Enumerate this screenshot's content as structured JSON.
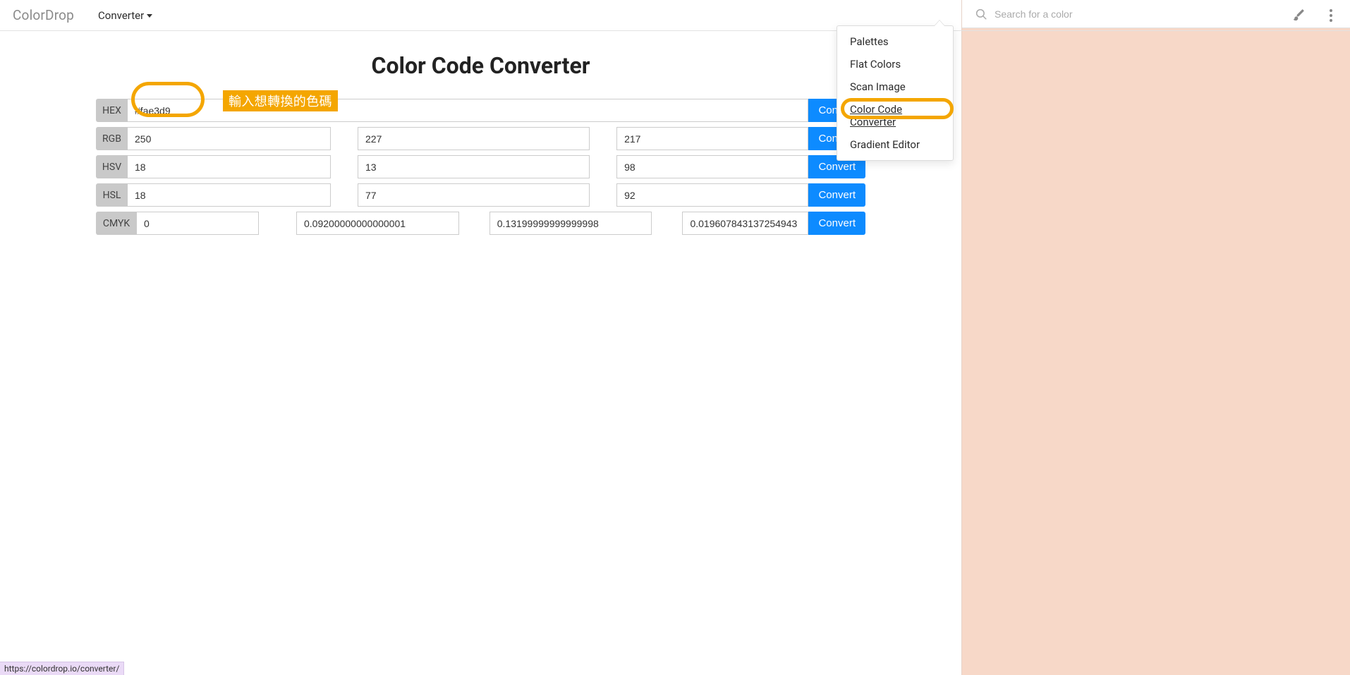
{
  "brand": "ColorDrop",
  "nav": {
    "converter": "Converter"
  },
  "search": {
    "placeholder": "Search for a color"
  },
  "dropdown": {
    "palettes": "Palettes",
    "flat_colors": "Flat Colors",
    "scan_image": "Scan Image",
    "color_code_converter": "Color Code Converter",
    "gradient_editor": "Gradient Editor"
  },
  "title": "Color Code Converter",
  "labels": {
    "hex": "HEX",
    "rgb": "RGB",
    "hsv": "HSV",
    "hsl": "HSL",
    "cmyk": "CMYK"
  },
  "buttons": {
    "convert": "Convert"
  },
  "values": {
    "hex": "#fae3d9",
    "rgb": {
      "r": "250",
      "g": "227",
      "b": "217"
    },
    "hsv": {
      "h": "18",
      "s": "13",
      "v": "98"
    },
    "hsl": {
      "h": "18",
      "s": "77",
      "l": "92"
    },
    "cmyk": {
      "c": "0",
      "m": "0.09200000000000001",
      "y": "0.13199999999999998",
      "k": "0.019607843137254943"
    }
  },
  "annotation": "輸入想轉換的色碼",
  "status_url": "https://colordrop.io/converter/"
}
